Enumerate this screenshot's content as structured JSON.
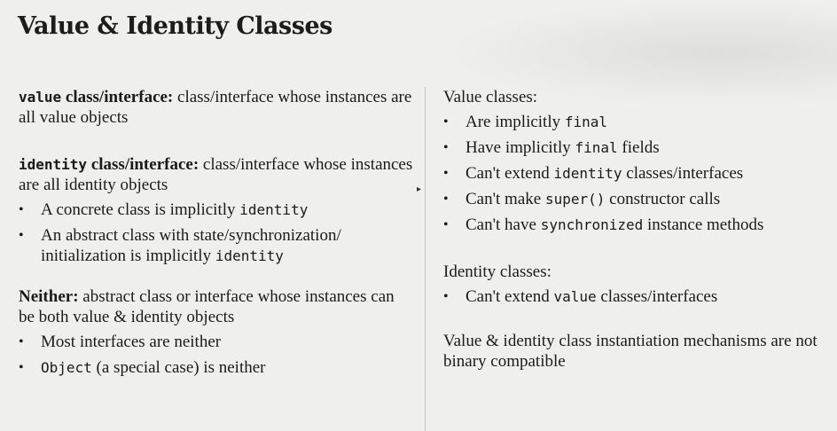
{
  "slide": {
    "title": "Value & Identity Classes"
  },
  "left": {
    "value_def": {
      "keyword": "value",
      "term_rest": " class/interface:",
      "desc": " class/interface whose instances are all value objects"
    },
    "identity_def": {
      "keyword": "identity",
      "term_rest": " class/interface:",
      "desc": " class/interface whose instances are all identity objects",
      "bullets": [
        {
          "text": "A concrete class is implicitly ",
          "code": "identity"
        },
        {
          "text": "An abstract class with state/synchronization/ initialization is implicitly ",
          "code": "identity"
        }
      ]
    },
    "neither_def": {
      "term": "Neither:",
      "desc": " abstract class or interface whose instances can be both value & identity objects",
      "bullets": [
        {
          "text": "Most interfaces are neither"
        },
        {
          "code": "Object",
          "text": " (a special case) is neither"
        }
      ]
    }
  },
  "right": {
    "value_classes": {
      "heading": "Value classes:",
      "bullets": [
        {
          "pre": "Are implicitly ",
          "code": "final",
          "post": ""
        },
        {
          "pre": "Have implicitly ",
          "code": "final",
          "post": " fields"
        },
        {
          "pre": "Can't extend ",
          "code": "identity",
          "post": " classes/interfaces"
        },
        {
          "pre": "Can't make ",
          "code": "super()",
          "post": " constructor calls"
        },
        {
          "pre": "Can't have ",
          "code": "synchronized",
          "post": " instance methods"
        }
      ]
    },
    "identity_classes": {
      "heading": "Identity classes:",
      "bullets": [
        {
          "pre": "Can't extend ",
          "code": "value",
          "post": " classes/interfaces"
        }
      ]
    },
    "note": "Value & identity class instantiation mechanisms are not binary compatible"
  }
}
